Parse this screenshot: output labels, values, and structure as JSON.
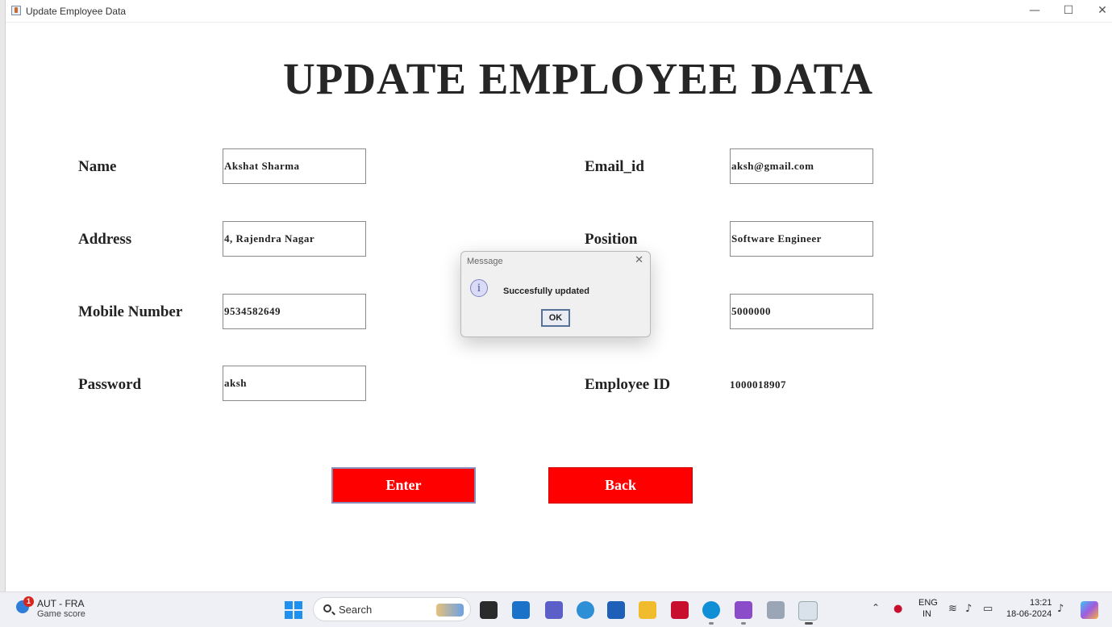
{
  "window": {
    "title": "Update Employee Data",
    "minimize": "—",
    "maximize": "☐",
    "close": "✕"
  },
  "heading": "UPDATE EMPLOYEE DATA",
  "form": {
    "name_label": "Name",
    "name_value": "Akshat Sharma",
    "address_label": "Address",
    "address_value": "4, Rajendra Nagar",
    "mobile_label": "Mobile Number",
    "mobile_value": "9534582649",
    "password_label": "Password",
    "password_value": "aksh",
    "email_label": "Email_id",
    "email_value": "aksh@gmail.com",
    "position_label": "Position",
    "position_value": "Software Engineer",
    "salary_value": "5000000",
    "empid_label": "Employee ID",
    "empid_value": "1000018907"
  },
  "buttons": {
    "enter": "Enter",
    "back": "Back"
  },
  "dialog": {
    "title": "Message",
    "close": "✕",
    "icon": "info-icon",
    "icon_glyph": "i",
    "message": "Succesfully updated",
    "ok": "OK"
  },
  "taskbar": {
    "widget_badge": "1",
    "widget_title": "AUT - FRA",
    "widget_subtitle": "Game score",
    "search_label": "Search",
    "language_top": "ENG",
    "language_bottom": "IN",
    "time": "13:21",
    "date": "18-06-2024",
    "colors": {
      "start": "#1f8ff0",
      "accent_red": "#ff0000"
    }
  }
}
